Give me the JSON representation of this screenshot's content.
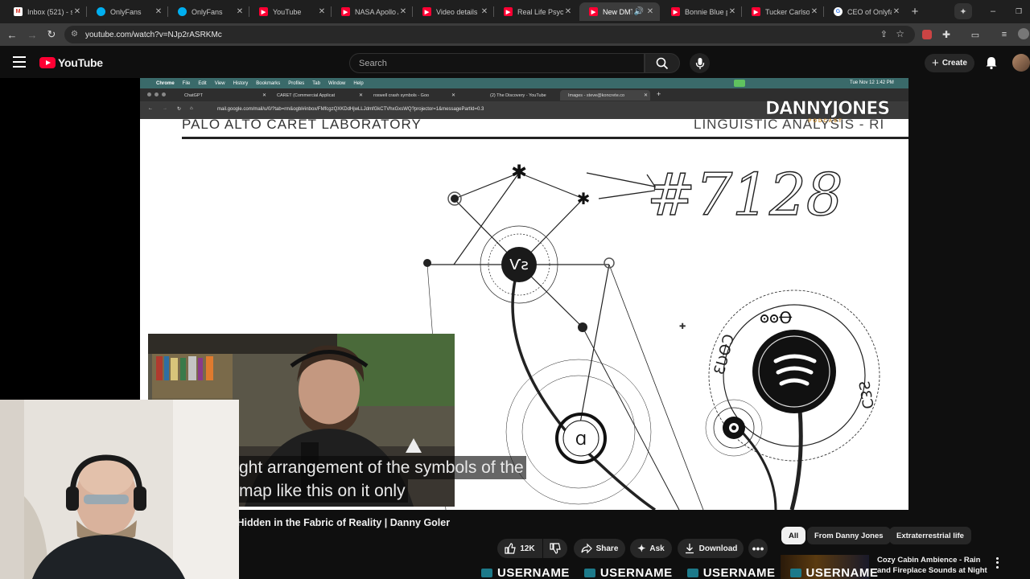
{
  "browser": {
    "tabs": [
      {
        "title": "Inbox (521) - s",
        "favicon": "gmail-icon"
      },
      {
        "title": "OnlyFans",
        "favicon": "onlyfans-icon"
      },
      {
        "title": "OnlyFans",
        "favicon": "onlyfans-icon"
      },
      {
        "title": "YouTube",
        "favicon": "youtube-icon"
      },
      {
        "title": "NASA Apollo A",
        "favicon": "youtube-icon"
      },
      {
        "title": "Video details",
        "favicon": "youtube-icon"
      },
      {
        "title": "Real Life Psych",
        "favicon": "youtube-icon"
      },
      {
        "title": "New DMT",
        "favicon": "youtube-icon",
        "active": true
      },
      {
        "title": "Bonnie Blue p",
        "favicon": "youtube-icon"
      },
      {
        "title": "Tucker Carlson",
        "favicon": "youtube-icon"
      },
      {
        "title": "CEO of Onlyfa",
        "favicon": "google-icon"
      }
    ],
    "url": "youtube.com/watch?v=NJp2rASRKMc"
  },
  "youtube": {
    "logo_text": "YouTube",
    "search_placeholder": "Search",
    "create_label": "Create"
  },
  "video": {
    "inner_menubar": [
      "Chrome",
      "File",
      "Edit",
      "View",
      "History",
      "Bookmarks",
      "Profiles",
      "Tab",
      "Window",
      "Help"
    ],
    "inner_clock": "Tue Nov 12  1:42 PM",
    "inner_tabs": [
      "ChatGPT",
      "CARET (Commercial Applicat",
      "roswell crash symbols - Goo",
      "(2) The Discovery - YouTube",
      "Images - steve@koncrete.co"
    ],
    "inner_url": "mail.google.com/mail/u/0/?tab=rm&ogbl#inbox/FMfcgzQXKDdHjwLLJdmfGkCTVhxGxsWQ?projector=1&messagePartId=0.3",
    "watermark_top": "DANNYJONES",
    "watermark_bottom": "PODCAST",
    "doc_header_left": "PALO ALTO CARET LABORATORY",
    "doc_header_right": "LINGUISTIC ANALYSIS - RI",
    "handwritten": "#7128",
    "caption_line1": "ght arrangement of the symbols of the",
    "caption_line2": "map like this on it only"
  },
  "below": {
    "title": "' Hidden in the Fabric of Reality | Danny Goler",
    "like_count": "12K",
    "share_label": "Share",
    "ask_label": "Ask",
    "download_label": "Download",
    "chips": [
      "All",
      "From Danny Jones",
      "Extraterrestrial life"
    ],
    "rec_title": "Cozy Cabin Ambience - Rain and Fireplace Sounds at Night",
    "ticker": [
      "USERNAME",
      "USERNAME",
      "USERNAME",
      "USERNAME"
    ]
  }
}
